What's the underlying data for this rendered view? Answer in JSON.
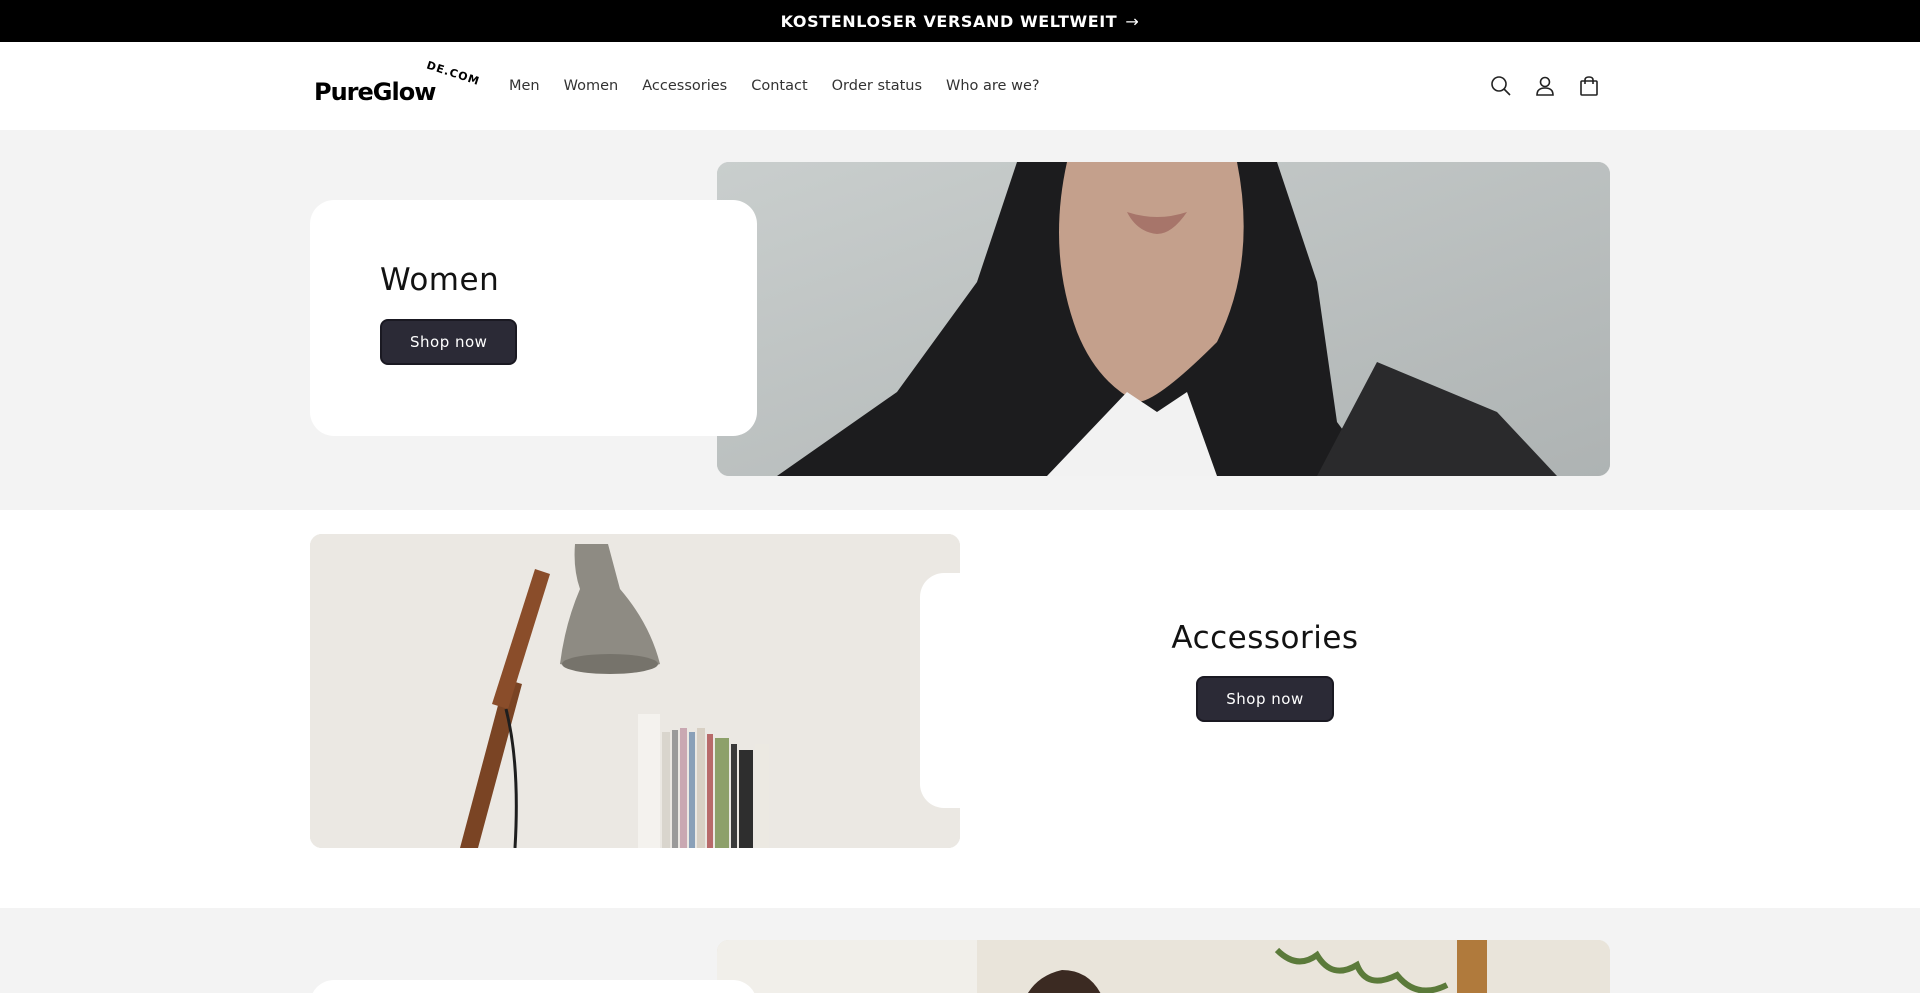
{
  "announcement": {
    "text": "KOSTENLOSER VERSAND WELTWEIT",
    "arrow": "→"
  },
  "header": {
    "logo_text": "PureGlow",
    "logo_suffix": "DE.COM",
    "nav": [
      "Men",
      "Women",
      "Accessories",
      "Contact",
      "Order status",
      "Who are we?"
    ],
    "icons": [
      "search-icon",
      "account-icon",
      "cart-icon"
    ]
  },
  "sections": {
    "women": {
      "title": "Women",
      "button": "Shop now"
    },
    "accessories": {
      "title": "Accessories",
      "button": "Shop now"
    }
  },
  "colors": {
    "announcement_bg": "#000000",
    "button_bg": "#2b2a36",
    "section_bg": "#f3f3f3"
  }
}
